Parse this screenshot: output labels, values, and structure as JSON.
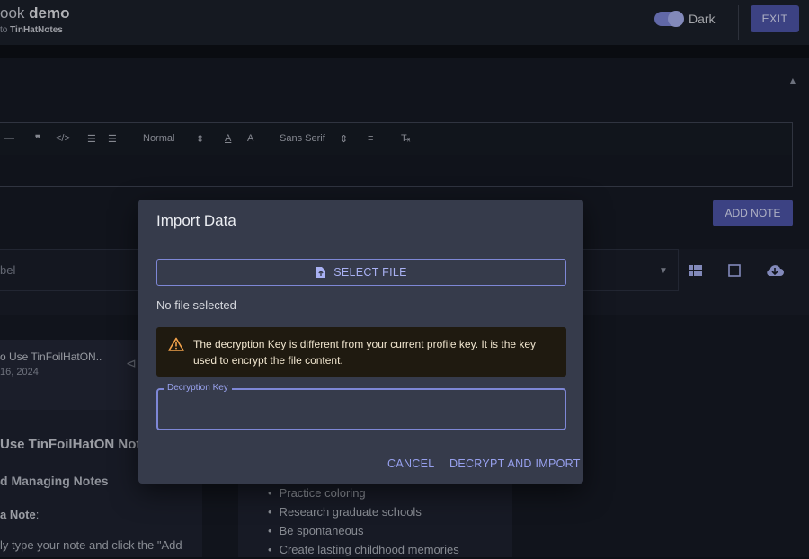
{
  "header": {
    "app_title_prefix": "ook",
    "app_title_bold": "demo",
    "subtitle_prefix": "to",
    "subtitle_bold": "TinHatNotes",
    "theme_label": "Dark",
    "exit_label": "EXIT"
  },
  "editor": {
    "heading_select": "Normal",
    "font_select": "Sans Serif",
    "add_note_label": "ADD NOTE"
  },
  "filter": {
    "label_placeholder": "bel"
  },
  "notes": {
    "card1": {
      "title": "o Use TinFoilHatON..",
      "date": "16, 2024",
      "heading": "Use TinFoilHatON Not",
      "subheading": "d Managing Notes",
      "item_bold": "a Note",
      "item_suffix": ":",
      "paragraph": "ly type your note and click the \"Add"
    },
    "card2": {
      "bullets": [
        "Practice coloring",
        "Research graduate schools",
        "Be spontaneous",
        "Create lasting childhood memories"
      ]
    }
  },
  "dialog": {
    "title": "Import Data",
    "select_file_label": "SELECT FILE",
    "status": "No file selected",
    "warning": "The decryption Key is different from your current profile key. It is the key used to encrypt the file content.",
    "key_label": "Decryption Key",
    "key_value": "",
    "cancel_label": "CANCEL",
    "confirm_label": "DECRYPT AND IMPORT"
  },
  "colors": {
    "accent": "#7e87d6",
    "button_bg": "#4e55a8",
    "dialog_bg": "#363b4b",
    "warning_bg": "#1f1a10",
    "warning_icon": "#f0a14a"
  }
}
